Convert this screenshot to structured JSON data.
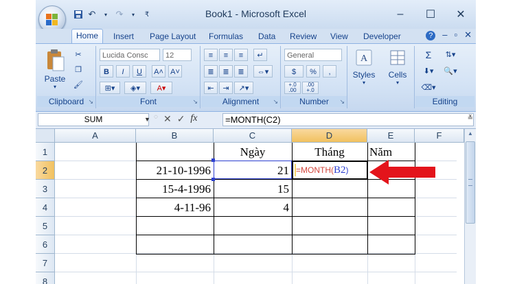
{
  "window": {
    "title": "Book1 - Microsoft Excel",
    "controls": [
      "–",
      "☐",
      "✕"
    ]
  },
  "tabs": [
    "Home",
    "Insert",
    "Page Layout",
    "Formulas",
    "Data",
    "Review",
    "View",
    "Developer"
  ],
  "ribbon": {
    "clipboard": {
      "label": "Clipboard",
      "paste": "Paste"
    },
    "font": {
      "label": "Font",
      "name": "Lucida Consc",
      "size": "12",
      "bold": "B",
      "italic": "I",
      "underline": "U"
    },
    "alignment": {
      "label": "Alignment"
    },
    "number": {
      "label": "Number",
      "format": "General",
      "dollar": "$",
      "percent": "%",
      "comma": ",",
      "inc_decimal": "+.0 .00",
      "dec_decimal": ".00 +.0"
    },
    "styles": {
      "label": "Styles"
    },
    "cells": {
      "label": "Cells"
    },
    "editing": {
      "label": "Editing",
      "sigma": "Σ"
    }
  },
  "formula_bar": {
    "name_box": "SUM",
    "fx": "fx",
    "formula": "=MONTH(C2)"
  },
  "columns": [
    "A",
    "B",
    "C",
    "D",
    "E",
    "F"
  ],
  "rows": [
    "1",
    "2",
    "3",
    "4",
    "5",
    "6",
    "7",
    "8"
  ],
  "cells": {
    "C1": "Ngày",
    "D1": "Tháng",
    "E1": "Năm",
    "B2": "21-10-1996",
    "C2": "21",
    "B3": "15-4-1996",
    "C3": "15",
    "B4": "4-11-96",
    "C4": "4",
    "D2_prefix": "=MONTH(",
    "D2_ref": "B2",
    "D2_suffix": ")"
  },
  "colors": {
    "accent_arrow": "#e3141b",
    "ref_highlight": "#2c3fd0",
    "formula_text": "#d2463c"
  }
}
